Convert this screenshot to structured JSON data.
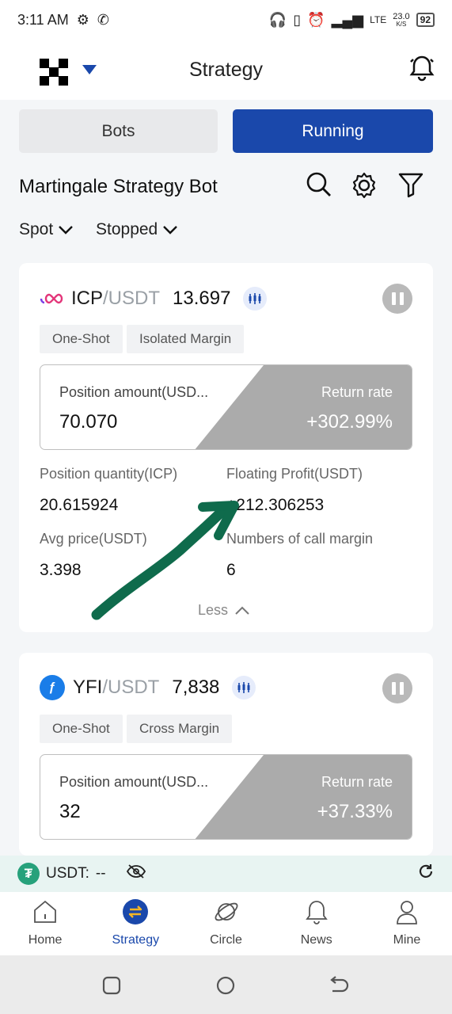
{
  "status_bar": {
    "time": "3:11 AM",
    "network": "LTE",
    "speed": "23.0",
    "speed_unit": "K/S",
    "battery": "92"
  },
  "header": {
    "title": "Strategy"
  },
  "segments": {
    "bots": "Bots",
    "running": "Running"
  },
  "section": {
    "title": "Martingale Strategy Bot"
  },
  "filters": {
    "market": "Spot",
    "status": "Stopped"
  },
  "cards": [
    {
      "base": "ICP",
      "quote": "/USDT",
      "price": "13.697",
      "tags": [
        "One-Shot",
        "Isolated Margin"
      ],
      "position_label": "Position amount(USD...",
      "position_value": "70.070",
      "return_label": "Return rate",
      "return_value": "+302.99%",
      "stats": {
        "qty_label": "Position quantity(ICP)",
        "qty_value": "20.615924",
        "profit_label": "Floating Profit(USDT)",
        "profit_value": "+212.306253",
        "avg_label": "Avg price(USDT)",
        "avg_value": "3.398",
        "calls_label": "Numbers of call margin",
        "calls_value": "6"
      },
      "less": "Less"
    },
    {
      "base": "YFI",
      "quote": "/USDT",
      "price": "7,838",
      "tags": [
        "One-Shot",
        "Cross Margin"
      ],
      "position_label": "Position amount(USD...",
      "position_value": "32",
      "return_label": "Return rate",
      "return_value": "+37.33%"
    }
  ],
  "balance": {
    "label": "USDT:",
    "value": "--"
  },
  "nav": [
    "Home",
    "Strategy",
    "Circle",
    "News",
    "Mine"
  ],
  "colors": {
    "accent": "#1a48ab",
    "annotation_arrow": "#0f6b4c",
    "tether": "#26a17b"
  }
}
